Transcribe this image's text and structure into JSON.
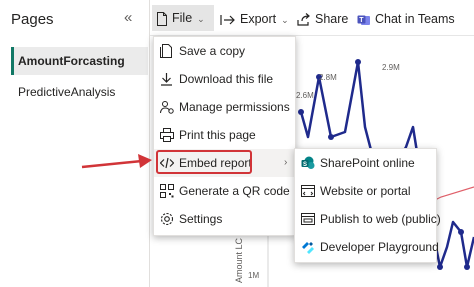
{
  "pages_pane": {
    "title": "Pages",
    "collapse_glyph": "«",
    "items": [
      {
        "label": "AmountForcasting",
        "active": true
      },
      {
        "label": "PredictiveAnalysis",
        "active": false
      }
    ]
  },
  "toolbar": {
    "file_label": "File",
    "export_label": "Export",
    "share_label": "Share",
    "teams_label": "Chat in Teams",
    "chevron": "⌄"
  },
  "file_menu": {
    "items": [
      {
        "label": "Save a copy",
        "icon": "save-copy-icon"
      },
      {
        "label": "Download this file",
        "icon": "download-icon"
      },
      {
        "label": "Manage permissions",
        "icon": "permissions-icon"
      },
      {
        "label": "Print this page",
        "icon": "print-icon"
      },
      {
        "label": "Embed report",
        "icon": "embed-icon",
        "has_submenu": true,
        "highlighted": true
      },
      {
        "label": "Generate a QR code",
        "icon": "qr-code-icon"
      },
      {
        "label": "Settings",
        "icon": "settings-icon"
      }
    ],
    "submenu_arrow": "›"
  },
  "embed_submenu": {
    "items": [
      {
        "label": "SharePoint online",
        "icon": "sharepoint-icon"
      },
      {
        "label": "Website or portal",
        "icon": "website-icon"
      },
      {
        "label": "Publish to web (public)",
        "icon": "publish-web-icon"
      },
      {
        "label": "Developer Playground",
        "icon": "developer-playground-icon"
      }
    ]
  },
  "chart": {
    "y_axis_label": "Amount LC",
    "y_tick_label": "1M",
    "data_labels": [
      "2.6M",
      "2.8M",
      "2.9M"
    ]
  },
  "colors": {
    "accent_green": "#117865",
    "highlight_red": "#d13438",
    "line_navy": "#1f2a8c",
    "forecast_red": "#e0606a"
  }
}
